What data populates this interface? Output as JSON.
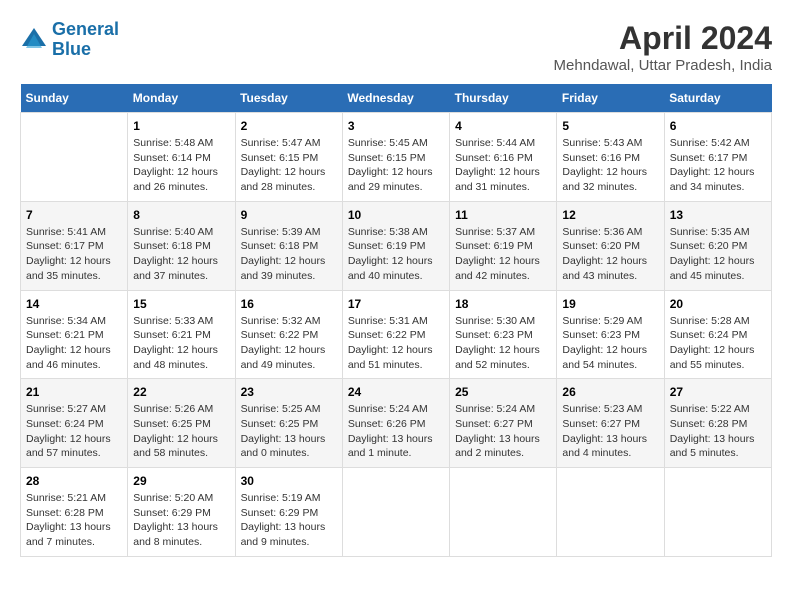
{
  "header": {
    "logo_line1": "General",
    "logo_line2": "Blue",
    "title": "April 2024",
    "subtitle": "Mehndawal, Uttar Pradesh, India"
  },
  "calendar": {
    "days_of_week": [
      "Sunday",
      "Monday",
      "Tuesday",
      "Wednesday",
      "Thursday",
      "Friday",
      "Saturday"
    ],
    "rows": [
      [
        {
          "num": "",
          "info": ""
        },
        {
          "num": "1",
          "info": "Sunrise: 5:48 AM\nSunset: 6:14 PM\nDaylight: 12 hours\nand 26 minutes."
        },
        {
          "num": "2",
          "info": "Sunrise: 5:47 AM\nSunset: 6:15 PM\nDaylight: 12 hours\nand 28 minutes."
        },
        {
          "num": "3",
          "info": "Sunrise: 5:45 AM\nSunset: 6:15 PM\nDaylight: 12 hours\nand 29 minutes."
        },
        {
          "num": "4",
          "info": "Sunrise: 5:44 AM\nSunset: 6:16 PM\nDaylight: 12 hours\nand 31 minutes."
        },
        {
          "num": "5",
          "info": "Sunrise: 5:43 AM\nSunset: 6:16 PM\nDaylight: 12 hours\nand 32 minutes."
        },
        {
          "num": "6",
          "info": "Sunrise: 5:42 AM\nSunset: 6:17 PM\nDaylight: 12 hours\nand 34 minutes."
        }
      ],
      [
        {
          "num": "7",
          "info": "Sunrise: 5:41 AM\nSunset: 6:17 PM\nDaylight: 12 hours\nand 35 minutes."
        },
        {
          "num": "8",
          "info": "Sunrise: 5:40 AM\nSunset: 6:18 PM\nDaylight: 12 hours\nand 37 minutes."
        },
        {
          "num": "9",
          "info": "Sunrise: 5:39 AM\nSunset: 6:18 PM\nDaylight: 12 hours\nand 39 minutes."
        },
        {
          "num": "10",
          "info": "Sunrise: 5:38 AM\nSunset: 6:19 PM\nDaylight: 12 hours\nand 40 minutes."
        },
        {
          "num": "11",
          "info": "Sunrise: 5:37 AM\nSunset: 6:19 PM\nDaylight: 12 hours\nand 42 minutes."
        },
        {
          "num": "12",
          "info": "Sunrise: 5:36 AM\nSunset: 6:20 PM\nDaylight: 12 hours\nand 43 minutes."
        },
        {
          "num": "13",
          "info": "Sunrise: 5:35 AM\nSunset: 6:20 PM\nDaylight: 12 hours\nand 45 minutes."
        }
      ],
      [
        {
          "num": "14",
          "info": "Sunrise: 5:34 AM\nSunset: 6:21 PM\nDaylight: 12 hours\nand 46 minutes."
        },
        {
          "num": "15",
          "info": "Sunrise: 5:33 AM\nSunset: 6:21 PM\nDaylight: 12 hours\nand 48 minutes."
        },
        {
          "num": "16",
          "info": "Sunrise: 5:32 AM\nSunset: 6:22 PM\nDaylight: 12 hours\nand 49 minutes."
        },
        {
          "num": "17",
          "info": "Sunrise: 5:31 AM\nSunset: 6:22 PM\nDaylight: 12 hours\nand 51 minutes."
        },
        {
          "num": "18",
          "info": "Sunrise: 5:30 AM\nSunset: 6:23 PM\nDaylight: 12 hours\nand 52 minutes."
        },
        {
          "num": "19",
          "info": "Sunrise: 5:29 AM\nSunset: 6:23 PM\nDaylight: 12 hours\nand 54 minutes."
        },
        {
          "num": "20",
          "info": "Sunrise: 5:28 AM\nSunset: 6:24 PM\nDaylight: 12 hours\nand 55 minutes."
        }
      ],
      [
        {
          "num": "21",
          "info": "Sunrise: 5:27 AM\nSunset: 6:24 PM\nDaylight: 12 hours\nand 57 minutes."
        },
        {
          "num": "22",
          "info": "Sunrise: 5:26 AM\nSunset: 6:25 PM\nDaylight: 12 hours\nand 58 minutes."
        },
        {
          "num": "23",
          "info": "Sunrise: 5:25 AM\nSunset: 6:25 PM\nDaylight: 13 hours\nand 0 minutes."
        },
        {
          "num": "24",
          "info": "Sunrise: 5:24 AM\nSunset: 6:26 PM\nDaylight: 13 hours\nand 1 minute."
        },
        {
          "num": "25",
          "info": "Sunrise: 5:24 AM\nSunset: 6:27 PM\nDaylight: 13 hours\nand 2 minutes."
        },
        {
          "num": "26",
          "info": "Sunrise: 5:23 AM\nSunset: 6:27 PM\nDaylight: 13 hours\nand 4 minutes."
        },
        {
          "num": "27",
          "info": "Sunrise: 5:22 AM\nSunset: 6:28 PM\nDaylight: 13 hours\nand 5 minutes."
        }
      ],
      [
        {
          "num": "28",
          "info": "Sunrise: 5:21 AM\nSunset: 6:28 PM\nDaylight: 13 hours\nand 7 minutes."
        },
        {
          "num": "29",
          "info": "Sunrise: 5:20 AM\nSunset: 6:29 PM\nDaylight: 13 hours\nand 8 minutes."
        },
        {
          "num": "30",
          "info": "Sunrise: 5:19 AM\nSunset: 6:29 PM\nDaylight: 13 hours\nand 9 minutes."
        },
        {
          "num": "",
          "info": ""
        },
        {
          "num": "",
          "info": ""
        },
        {
          "num": "",
          "info": ""
        },
        {
          "num": "",
          "info": ""
        }
      ]
    ]
  }
}
